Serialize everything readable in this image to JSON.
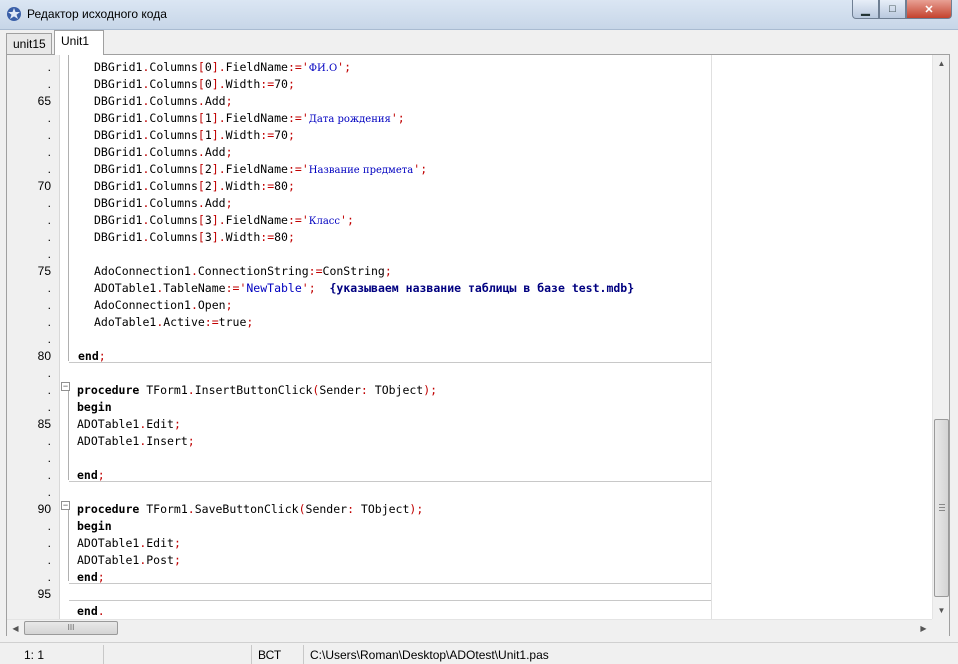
{
  "window": {
    "title": "Редактор исходного кода",
    "controls": {
      "minimize": "▁",
      "maximize": "□",
      "close": "✕"
    }
  },
  "tabs": [
    {
      "label": "unit15",
      "active": false
    },
    {
      "label": "Unit1",
      "active": true
    }
  ],
  "gutter": {
    "line_markers": [
      ".",
      ".",
      "65",
      ".",
      ".",
      ".",
      ".",
      "70",
      ".",
      ".",
      ".",
      ".",
      "75",
      ".",
      ".",
      ".",
      ".",
      "80",
      ".",
      ".",
      ".",
      "85",
      ".",
      ".",
      ".",
      ".",
      "90",
      ".",
      ".",
      ".",
      ".",
      "95"
    ]
  },
  "code": {
    "lines": [
      "DBGrid1.Columns[0].FieldName:='ФИ.О';",
      "DBGrid1.Columns[0].Width:=70;",
      "DBGrid1.Columns.Add;",
      "DBGrid1.Columns[1].FieldName:='Дата рождения';",
      "DBGrid1.Columns[1].Width:=70;",
      "DBGrid1.Columns.Add;",
      "DBGrid1.Columns[2].FieldName:='Название предмета';",
      "DBGrid1.Columns[2].Width:=80;",
      "DBGrid1.Columns.Add;",
      "DBGrid1.Columns[3].FieldName:='Класс';",
      "DBGrid1.Columns[3].Width:=80;",
      "",
      "AdoConnection1.ConnectionString:=ConString;",
      "ADOTable1.TableName:='NewTable';  {указываем название таблицы в базе test.mdb}",
      "AdoConnection1.Open;",
      "AdoTable1.Active:=true;",
      "",
      "end;",
      "",
      "procedure TForm1.InsertButtonClick(Sender: TObject);",
      "begin",
      "ADOTable1.Edit;",
      "ADOTable1.Insert;",
      "",
      "end;",
      "",
      "procedure TForm1.SaveButtonClick(Sender: TObject);",
      "begin",
      "ADOTable1.Edit;",
      "ADOTable1.Post;",
      "end;",
      "",
      "end."
    ]
  },
  "scrollbars": {
    "vertical_position_fraction": 0.72,
    "horizontal_thumb_grip": "III"
  },
  "statusbar": {
    "cursor": "1:   1",
    "mode": "",
    "encoding": "ВСТ",
    "file_path": "C:\\Users\\Roman\\Desktop\\ADOtest\\Unit1.pas"
  },
  "colors": {
    "keyword": "#000000",
    "string": "#0000c0",
    "symbol": "#c00000",
    "comment": "#000080"
  }
}
